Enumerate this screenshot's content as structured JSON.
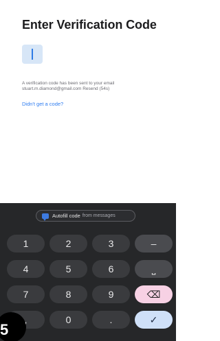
{
  "header": {
    "title": "Enter Verification Code"
  },
  "code_input": {
    "value": ""
  },
  "info": {
    "text": "A verification code has been sent to your email stuart.m.diamond@gmail.com Resend (54s)"
  },
  "help_link": {
    "label": "Didn't get a code?"
  },
  "keyboard": {
    "autofill": {
      "label": "Autofill code",
      "sub_label": "from messages"
    },
    "keys": {
      "k1": "1",
      "k2": "2",
      "k3": "3",
      "minus": "–",
      "k4": "4",
      "k5": "5",
      "k6": "6",
      "space": "⎵",
      "k7": "7",
      "k8": "8",
      "k9": "9",
      "backspace": "⌫",
      "comma": ",",
      "k0": "0",
      "period": ".",
      "enter": "✓"
    }
  },
  "corner_badge": {
    "text": "5"
  }
}
